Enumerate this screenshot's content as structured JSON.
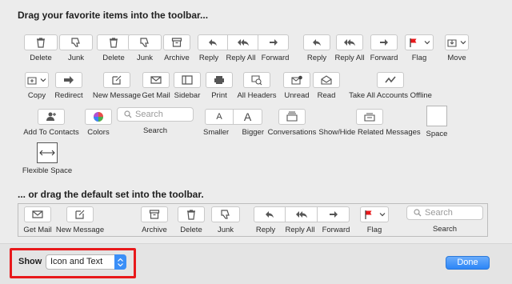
{
  "headings": {
    "drag_items": "Drag your favorite items into the toolbar...",
    "drag_default": "... or drag the default set into the toolbar."
  },
  "items": {
    "delete_1": "Delete",
    "junk_1": "Junk",
    "delete_2": "Delete",
    "junk_2": "Junk",
    "archive": "Archive",
    "reply_1": "Reply",
    "reply_all_1": "Reply All",
    "forward_1": "Forward",
    "reply_2": "Reply",
    "reply_all_2": "Reply All",
    "forward_2": "Forward",
    "flag": "Flag",
    "move": "Move",
    "copy": "Copy",
    "redirect": "Redirect",
    "new_message": "New Message",
    "get_mail": "Get Mail",
    "sidebar": "Sidebar",
    "print": "Print",
    "all_headers": "All Headers",
    "unread": "Unread",
    "read": "Read",
    "take_offline": "Take All Accounts Offline",
    "add_contacts": "Add To Contacts",
    "colors": "Colors",
    "search": "Search",
    "smaller": "Smaller",
    "bigger": "Bigger",
    "conversations": "Conversations",
    "show_hide_related": "Show/Hide Related Messages",
    "space": "Space",
    "flexible_space": "Flexible Space"
  },
  "search_placeholder": "Search",
  "font_glyph": "A",
  "default_set": {
    "get_mail": "Get Mail",
    "new_message": "New Message",
    "archive": "Archive",
    "delete": "Delete",
    "junk": "Junk",
    "reply": "Reply",
    "reply_all": "Reply All",
    "forward": "Forward",
    "flag": "Flag",
    "search": "Search",
    "search_placeholder": "Search"
  },
  "footer": {
    "show_label": "Show",
    "show_value": "Icon and Text",
    "done_label": "Done"
  },
  "colors": {
    "flag_red": "#e8191b",
    "highlight_red": "#e8191b",
    "accent_blue": "#2c85f7"
  }
}
